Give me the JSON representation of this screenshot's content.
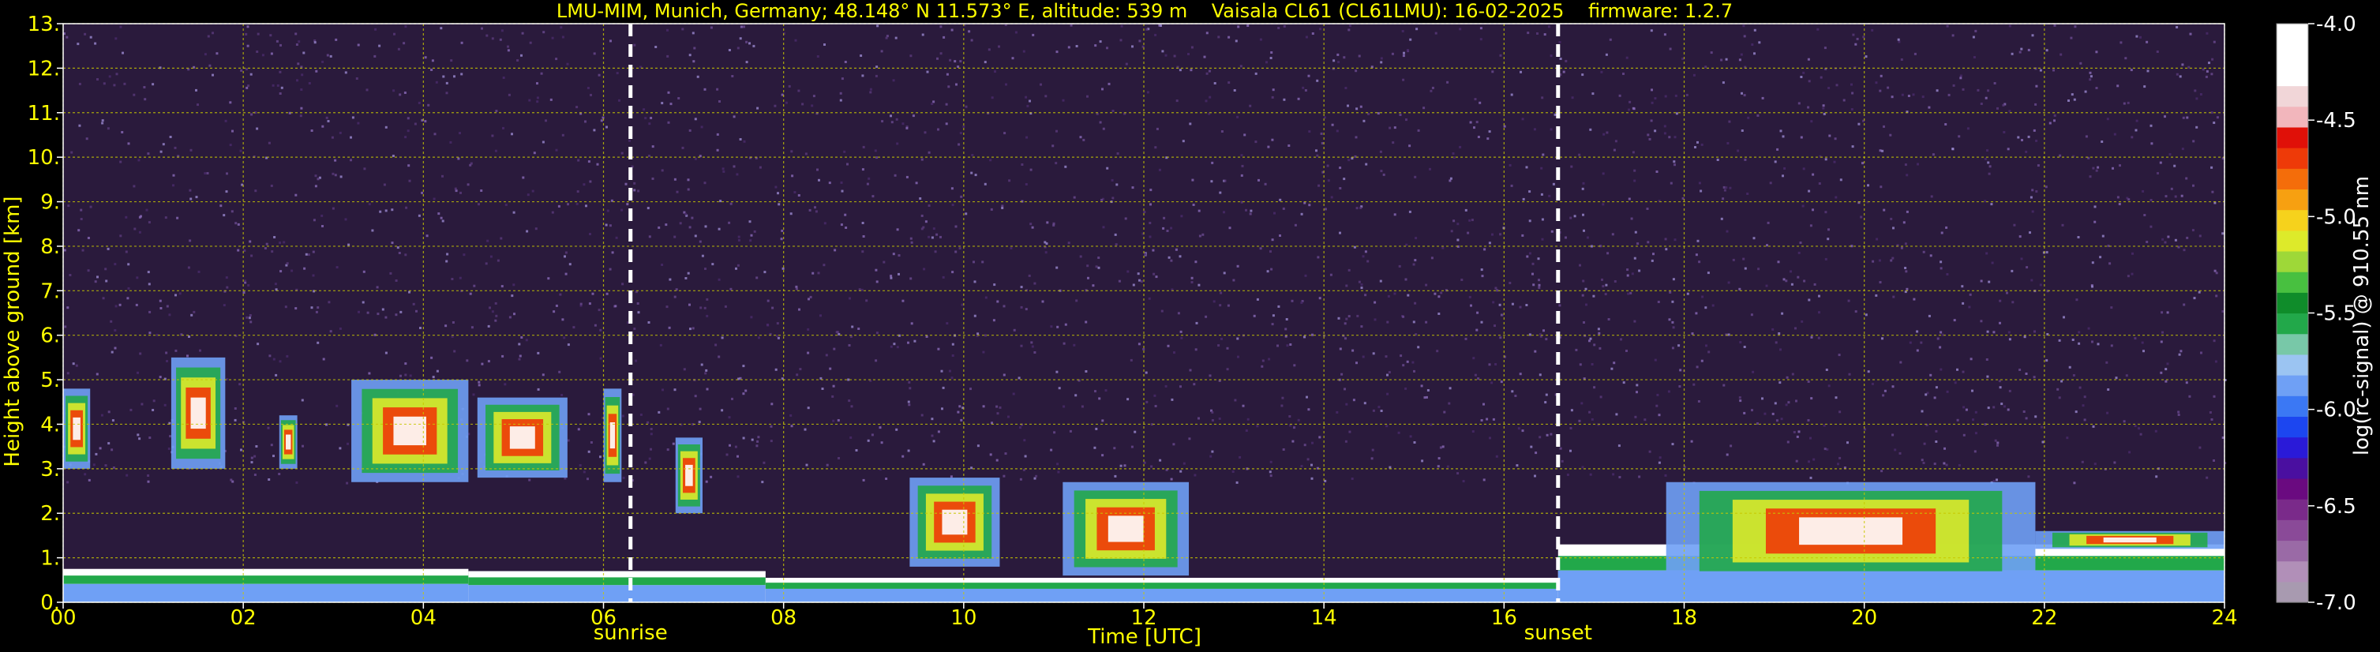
{
  "chart_data": {
    "type": "heatmap",
    "title": "LMU-MIM, Munich, Germany; 48.148° N 11.573° E, altitude: 539 m    Vaisala CL61 (CL61LMU): 16-02-2025    firmware: 1.2.7",
    "xlabel": "Time [UTC]",
    "ylabel": "Height above ground [km]",
    "xlim": [
      0,
      24
    ],
    "ylim": [
      0,
      13
    ],
    "x_ticks": [
      "00",
      "02",
      "04",
      "06",
      "08",
      "10",
      "12",
      "14",
      "16",
      "18",
      "20",
      "22",
      "24"
    ],
    "y_ticks": [
      "0.",
      "1.",
      "2.",
      "3.",
      "4.",
      "5.",
      "6.",
      "7.",
      "8.",
      "9.",
      "10.",
      "11.",
      "12.",
      "13."
    ],
    "grid": true,
    "colorbar": {
      "label": "log(rc-signal) @ 910.55 nm",
      "range": [
        -7.0,
        -4.0
      ],
      "ticks": [
        "-4.0",
        "-4.5",
        "-5.0",
        "-5.5",
        "-6.0",
        "-6.5",
        "-7.0"
      ],
      "colors": [
        "#a89ab0",
        "#b18fb8",
        "#9a6aa6",
        "#8a4a98",
        "#7a2a8a",
        "#6a0a80",
        "#4a0fa0",
        "#2a1ad8",
        "#1c46f0",
        "#3b78f4",
        "#6fa0f5",
        "#9bc4f2",
        "#78c8a8",
        "#22a84a",
        "#0f8c2a",
        "#48c040",
        "#9ed838",
        "#ddea2a",
        "#f6d21c",
        "#f7a011",
        "#f46d0a",
        "#ee3a08",
        "#e01008",
        "#f2b6bc",
        "#f1d6d8",
        "#ffffff",
        "#ffffff",
        "#ffffff"
      ]
    },
    "markers": [
      {
        "label": "sunrise",
        "x": 6.3
      },
      {
        "label": "sunset",
        "x": 16.6
      }
    ],
    "features": {
      "boundary_layer": [
        {
          "x_start": 0.0,
          "x_end": 4.5,
          "y_top": 0.75
        },
        {
          "x_start": 4.5,
          "x_end": 7.8,
          "y_top": 0.7
        },
        {
          "x_start": 7.8,
          "x_end": 16.6,
          "y_top": 0.55
        },
        {
          "x_start": 16.6,
          "x_end": 24.0,
          "y_top": 1.3
        }
      ],
      "cloud_layers": [
        {
          "x_start": 0.0,
          "x_end": 0.3,
          "y_bottom": 3.0,
          "y_top": 4.8
        },
        {
          "x_start": 1.2,
          "x_end": 1.8,
          "y_bottom": 3.0,
          "y_top": 5.5
        },
        {
          "x_start": 2.4,
          "x_end": 2.6,
          "y_bottom": 3.0,
          "y_top": 4.2
        },
        {
          "x_start": 3.2,
          "x_end": 4.5,
          "y_bottom": 2.7,
          "y_top": 5.0
        },
        {
          "x_start": 4.6,
          "x_end": 5.6,
          "y_bottom": 2.8,
          "y_top": 4.6
        },
        {
          "x_start": 6.0,
          "x_end": 6.2,
          "y_bottom": 2.7,
          "y_top": 4.8
        },
        {
          "x_start": 6.8,
          "x_end": 7.1,
          "y_bottom": 2.0,
          "y_top": 3.7
        },
        {
          "x_start": 9.4,
          "x_end": 10.4,
          "y_bottom": 0.8,
          "y_top": 2.8
        },
        {
          "x_start": 11.1,
          "x_end": 12.5,
          "y_bottom": 0.6,
          "y_top": 2.7
        },
        {
          "x_start": 17.8,
          "x_end": 21.9,
          "y_bottom": 0.5,
          "y_top": 2.7
        },
        {
          "x_start": 21.9,
          "x_end": 24.0,
          "y_bottom": 1.2,
          "y_top": 1.6
        }
      ]
    }
  }
}
